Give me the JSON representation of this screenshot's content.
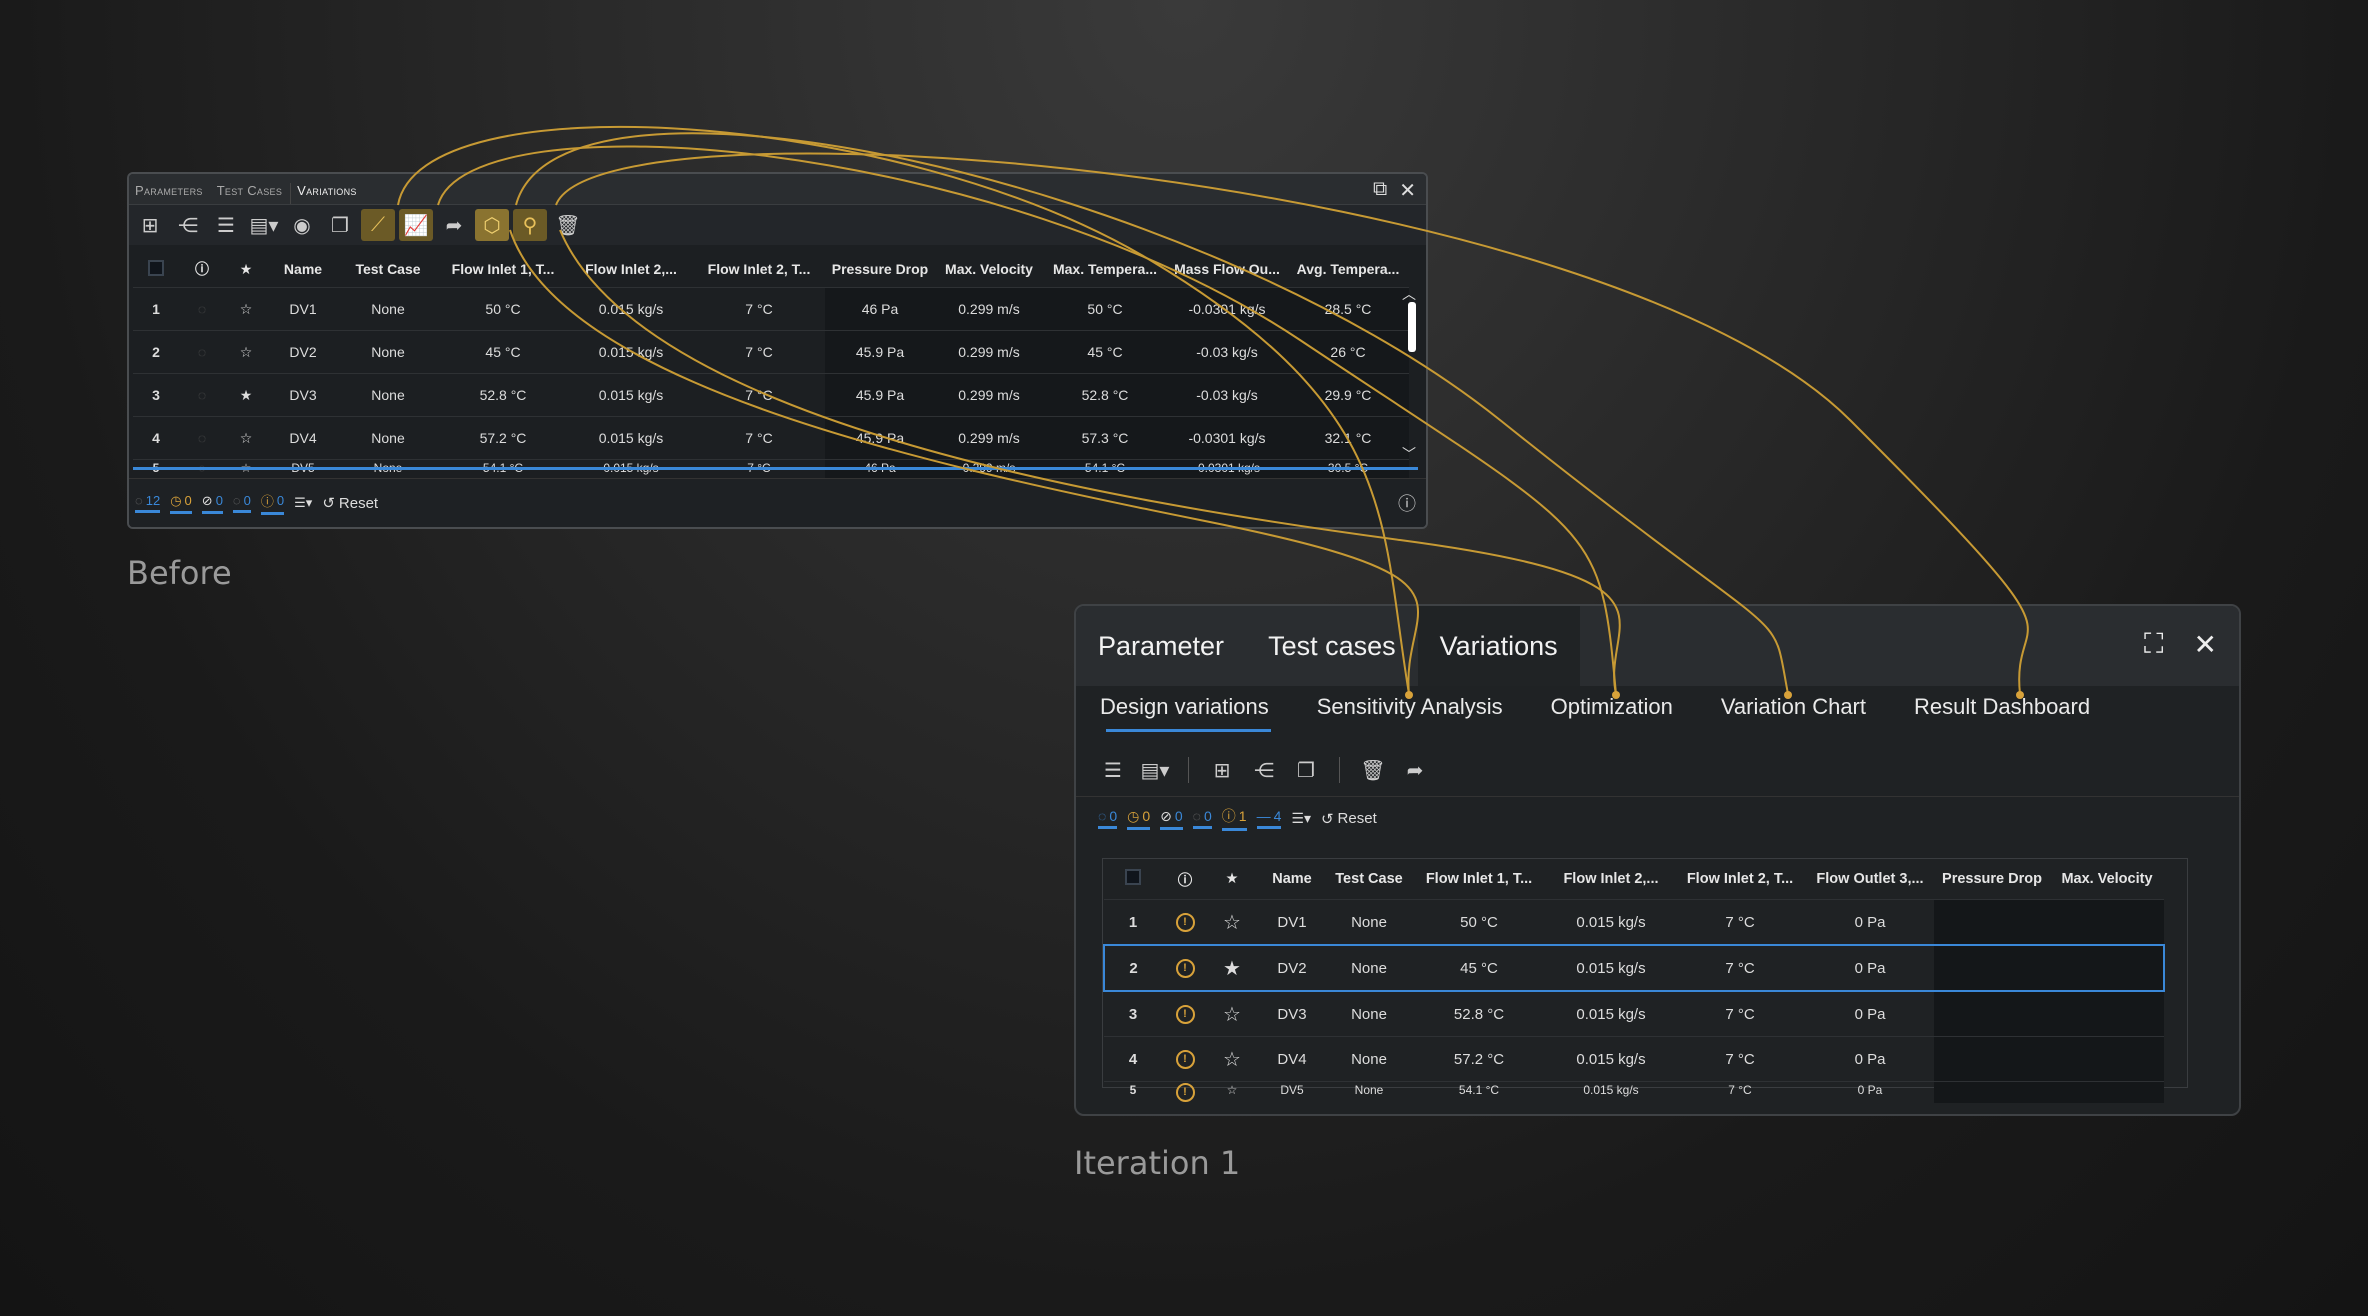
{
  "before": {
    "label": "Before",
    "tabs": [
      "Parameters",
      "Test Cases",
      "Variations"
    ],
    "columns": [
      "",
      "",
      "★",
      "Name",
      "Test Case",
      "Flow Inlet 1, T...",
      "Flow Inlet 2,...",
      "Flow Inlet 2, T...",
      "Pressure Drop",
      "Max. Velocity",
      "Max. Tempera...",
      "Mass Flow Ou...",
      "Avg. Tempera..."
    ],
    "rows": [
      {
        "num": "1",
        "name": "DV1",
        "tc": "None",
        "fi1": "50 °C",
        "fi2": "0.015 kg/s",
        "fi2t": "7 °C",
        "pd": "46 Pa",
        "mv": "0.299 m/s",
        "mt": "50 °C",
        "mf": "-0.0301 kg/s",
        "at": "28.5 °C",
        "star": false
      },
      {
        "num": "2",
        "name": "DV2",
        "tc": "None",
        "fi1": "45 °C",
        "fi2": "0.015 kg/s",
        "fi2t": "7 °C",
        "pd": "45.9 Pa",
        "mv": "0.299 m/s",
        "mt": "45 °C",
        "mf": "-0.03 kg/s",
        "at": "26 °C",
        "star": false
      },
      {
        "num": "3",
        "name": "DV3",
        "tc": "None",
        "fi1": "52.8 °C",
        "fi2": "0.015 kg/s",
        "fi2t": "7 °C",
        "pd": "45.9 Pa",
        "mv": "0.299 m/s",
        "mt": "52.8 °C",
        "mf": "-0.03 kg/s",
        "at": "29.9 °C",
        "star": true
      },
      {
        "num": "4",
        "name": "DV4",
        "tc": "None",
        "fi1": "57.2 °C",
        "fi2": "0.015 kg/s",
        "fi2t": "7 °C",
        "pd": "45.9 Pa",
        "mv": "0.299 m/s",
        "mt": "57.3 °C",
        "mf": "-0.0301 kg/s",
        "at": "32.1 °C",
        "star": false
      },
      {
        "num": "5",
        "name": "DV5",
        "tc": "None",
        "fi1": "54.1 °C",
        "fi2": "0.015 kg/s",
        "fi2t": "7 °C",
        "pd": "46 Pa",
        "mv": "0.299 m/s",
        "mt": "54.1 °C",
        "mf": "-0.0301 kg/s",
        "at": "30.5 °C",
        "star": false
      }
    ],
    "counters": [
      "12",
      "0",
      "0",
      "0",
      "0"
    ],
    "reset": "Reset"
  },
  "iteration": {
    "label": "Iteration 1",
    "tabs": [
      "Parameter",
      "Test cases",
      "Variations"
    ],
    "subtabs": [
      "Design variations",
      "Sensitivity Analysis",
      "Optimization",
      "Variation Chart",
      "Result Dashboard"
    ],
    "counters": [
      "0",
      "0",
      "0",
      "0",
      "1",
      "4"
    ],
    "reset": "Reset",
    "columns": [
      "",
      "",
      "★",
      "Name",
      "Test Case",
      "Flow Inlet 1, T...",
      "Flow Inlet 2,...",
      "Flow Inlet 2, T...",
      "Flow Outlet 3,...",
      "Pressure Drop",
      "Max. Velocity"
    ],
    "rows": [
      {
        "num": "1",
        "name": "DV1",
        "tc": "None",
        "fi1": "50 °C",
        "fi2": "0.015 kg/s",
        "fi2t": "7 °C",
        "fo3": "0 Pa",
        "star": false
      },
      {
        "num": "2",
        "name": "DV2",
        "tc": "None",
        "fi1": "45 °C",
        "fi2": "0.015 kg/s",
        "fi2t": "7 °C",
        "fo3": "0 Pa",
        "star": true
      },
      {
        "num": "3",
        "name": "DV3",
        "tc": "None",
        "fi1": "52.8 °C",
        "fi2": "0.015 kg/s",
        "fi2t": "7 °C",
        "fo3": "0 Pa",
        "star": false
      },
      {
        "num": "4",
        "name": "DV4",
        "tc": "None",
        "fi1": "57.2 °C",
        "fi2": "0.015 kg/s",
        "fi2t": "7 °C",
        "fo3": "0 Pa",
        "star": false
      },
      {
        "num": "5",
        "name": "DV5",
        "tc": "None",
        "fi1": "54.1 °C",
        "fi2": "0.015 kg/s",
        "fi2t": "7 °C",
        "fo3": "0 Pa",
        "star": false
      }
    ]
  },
  "colors": {
    "accent": "#d8a23a",
    "blue": "#3a88d8"
  }
}
